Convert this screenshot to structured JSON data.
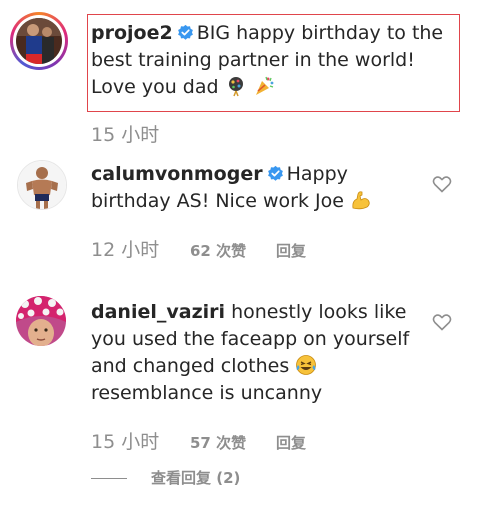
{
  "caption": {
    "username": "projoe2",
    "text_line1": "BIG happy birthday to the",
    "text_line2": "best training partner in the world!",
    "text_line3": "Love you dad",
    "emojis": [
      "balloon-icon",
      "party-popper-icon"
    ],
    "time": "15 小时"
  },
  "comments": [
    {
      "username": "calumvonmoger",
      "text_line1": "Happy",
      "text_line2": "birthday AS! Nice work Joe",
      "emoji": "flexed-biceps-icon",
      "time": "12 小时",
      "likes": "62 次赞",
      "reply": "回复"
    },
    {
      "username": "daniel_vaziri",
      "text_line1": "honestly looks like",
      "text_line2": "you used the faceapp on yourself",
      "text_line3": "and changed clothes",
      "text_line4": "resemblance is uncanny",
      "emoji": "laughing-tears-icon",
      "time": "15 小时",
      "likes": "57 次赞",
      "reply": "回复",
      "view_replies": "查看回复 (2)"
    }
  ],
  "colors": {
    "text": "#262626",
    "meta": "#8e8e8e",
    "verified": "#3897f0",
    "highlight": "#e0454b"
  }
}
